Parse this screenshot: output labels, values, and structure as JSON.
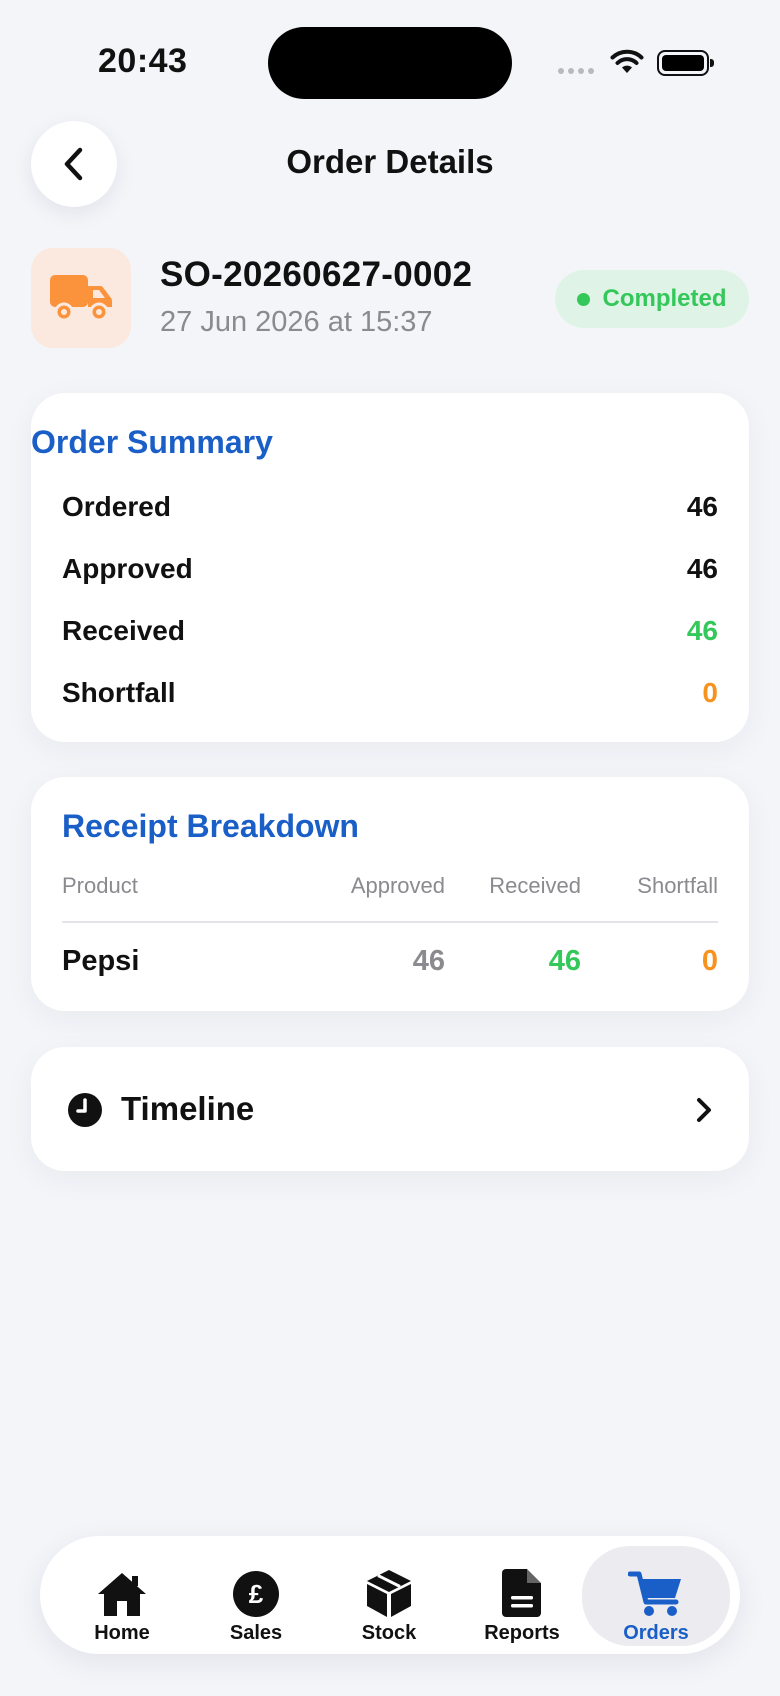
{
  "status_bar": {
    "time": "20:43"
  },
  "header": {
    "title": "Order Details"
  },
  "order": {
    "number": "SO-20260627-0002",
    "date": "27 Jun 2026 at 15:37",
    "status": "Completed"
  },
  "summary": {
    "title": "Order Summary",
    "rows": [
      {
        "label": "Ordered",
        "value": "46"
      },
      {
        "label": "Approved",
        "value": "46"
      },
      {
        "label": "Received",
        "value": "46"
      },
      {
        "label": "Shortfall",
        "value": "0"
      }
    ]
  },
  "receipt": {
    "title": "Receipt Breakdown",
    "columns": [
      "Product",
      "Approved",
      "Received",
      "Shortfall"
    ],
    "rows": [
      {
        "product": "Pepsi",
        "approved": "46",
        "received": "46",
        "shortfall": "0"
      }
    ]
  },
  "timeline": {
    "label": "Timeline"
  },
  "tabs": [
    {
      "label": "Home",
      "icon": "house-icon"
    },
    {
      "label": "Sales",
      "icon": "pound-icon"
    },
    {
      "label": "Stock",
      "icon": "box-icon"
    },
    {
      "label": "Reports",
      "icon": "document-icon"
    },
    {
      "label": "Orders",
      "icon": "cart-icon",
      "active": true
    }
  ],
  "colors": {
    "accent": "#1a5fc7",
    "success": "#34c759",
    "warning": "#f7921e",
    "truck": "#fb923c"
  }
}
